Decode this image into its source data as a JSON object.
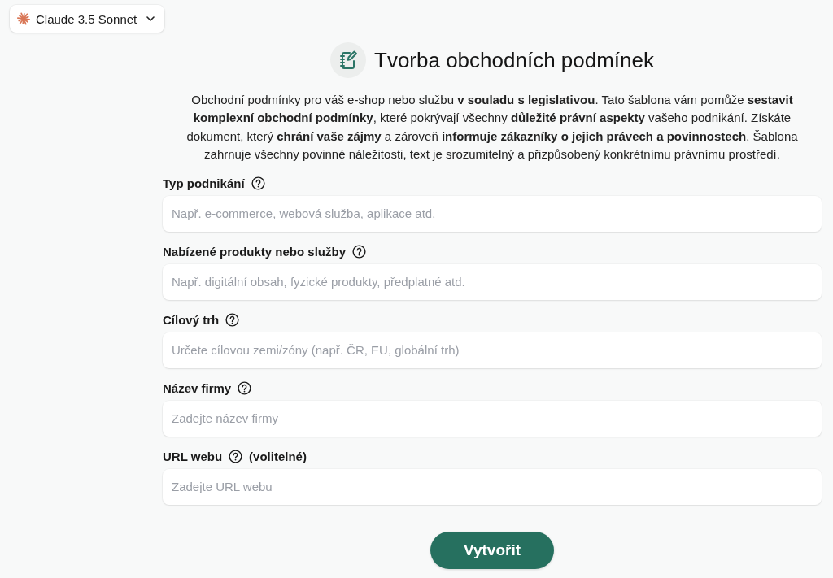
{
  "model_selector": {
    "label": "Claude 3.5 Sonnet"
  },
  "header": {
    "title": "Tvorba obchodních podmínek"
  },
  "description": "Obchodní podmínky pro váš e-shop nebo službu **v souladu s legislativou**. Tato šablona vám pomůže **sestavit komplexní obchodní podmínky**, které pokrývají všechny **důležité právní aspekty** vašeho podnikání. Získáte dokument, který **chrání vaše zájmy** a zároveň **informuje zákazníky o jejich právech a povinnostech**. Šablona zahrnuje všechny povinné náležitosti, text je srozumitelný a přizpůsobený konkrétnímu právnímu prostředí.",
  "fields": [
    {
      "label": "Typ podnikání",
      "placeholder": "Např. e-commerce, webová služba, aplikace atd."
    },
    {
      "label": "Nabízené produkty nebo služby",
      "placeholder": "Např. digitální obsah, fyzické produkty, předplatné atd."
    },
    {
      "label": "Cílový trh",
      "placeholder": "Určete cílovou zemi/zóny (např. ČR, EU, globální trh)"
    },
    {
      "label": "Název firmy",
      "placeholder": "Zadejte název firmy"
    },
    {
      "label": "URL webu",
      "note": "(volitelné)",
      "placeholder": "Zadejte URL webu"
    }
  ],
  "submit_button": {
    "label": "Vytvořit"
  }
}
